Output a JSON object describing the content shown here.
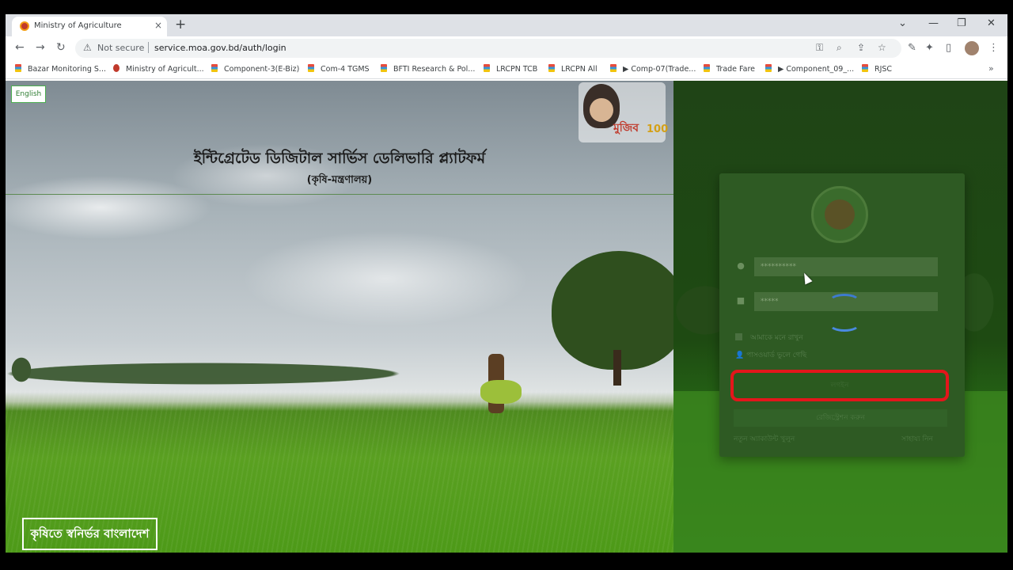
{
  "browser": {
    "tab_title": "Ministry of Agriculture",
    "tab_close": "×",
    "new_tab": "+",
    "win_min": "—",
    "win_max": "❐",
    "win_close": "✕",
    "win_down": "⌄",
    "back": "←",
    "forward": "→",
    "reload": "↻",
    "not_secure": "Not secure",
    "url": "service.moa.gov.bd/auth/login",
    "bookmarks": [
      "Bazar Monitoring S...",
      "Ministry of Agricult...",
      "Component-3(E-Biz)",
      "Com-4 TGMS",
      "BFTI Research & Pol...",
      "LRCPN TCB",
      "LRCPN All",
      "▶ Comp-07(Trade...",
      "Trade Fare",
      "▶ Component_09_...",
      "RJSC"
    ],
    "bookmarks_more": "»"
  },
  "page": {
    "language_button": "English",
    "logo_text": "মুজিব",
    "logo_number": "100",
    "title": "ইন্টিগ্রেটেড ডিজিটাল সার্ভিস ডেলিভারি প্ল্যাটফর্ম",
    "subtitle": "(কৃষি-মন্ত্রণালয়)",
    "slogan": "কৃষিতে স্বনির্ভর বাংলাদেশ"
  },
  "login": {
    "username_value": "**********",
    "password_value": "*****",
    "remember_label": "আমাকে মনে রাখুন",
    "forgot_label": "পাসওয়ার্ড ভুলে গেছি",
    "login_button": "লগইন",
    "register_button": "রেজিস্ট্রেশন করুন",
    "link_left": "নতুন অ্যাকাউন্ট খুলুন",
    "link_right": "সাহায্য নিন"
  }
}
